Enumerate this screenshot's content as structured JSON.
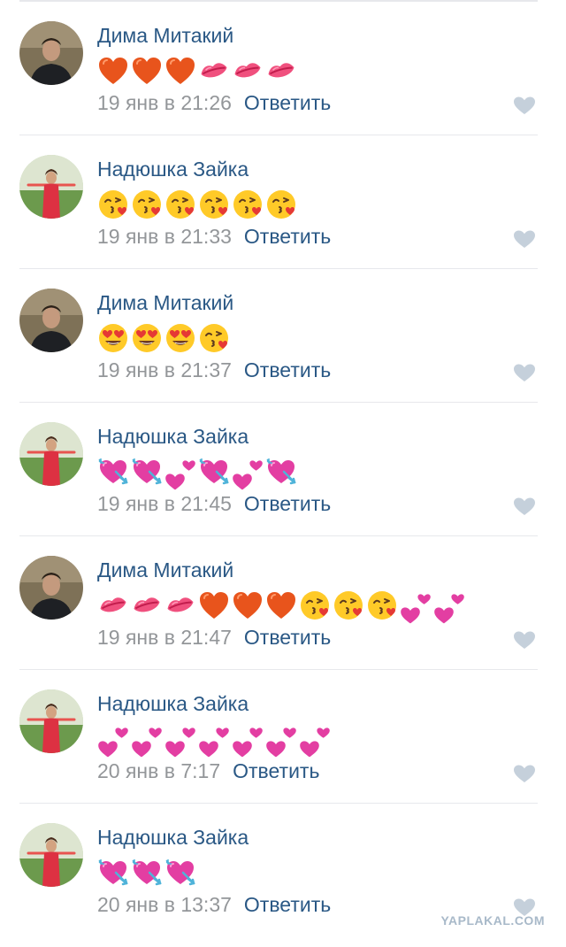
{
  "comments": [
    {
      "author": "Дима Митакий",
      "avatar": "man",
      "date": "19 янв в 21:26",
      "reply": "Ответить",
      "emojis": [
        "heart-icon",
        "heart-icon",
        "heart-icon",
        "kiss-mark-icon",
        "kiss-mark-icon",
        "kiss-mark-icon"
      ]
    },
    {
      "author": "Надюшка Зайка",
      "avatar": "woman",
      "date": "19 янв в 21:33",
      "reply": "Ответить",
      "emojis": [
        "face-blowing-kiss-icon",
        "face-blowing-kiss-icon",
        "face-blowing-kiss-icon",
        "face-blowing-kiss-icon",
        "face-blowing-kiss-icon",
        "face-blowing-kiss-icon"
      ]
    },
    {
      "author": "Дима Митакий",
      "avatar": "man",
      "date": "19 янв в 21:37",
      "reply": "Ответить",
      "emojis": [
        "heart-eyes-face-icon",
        "heart-eyes-face-icon",
        "heart-eyes-face-icon",
        "face-blowing-kiss-icon"
      ]
    },
    {
      "author": "Надюшка Зайка",
      "avatar": "woman",
      "date": "19 янв в 21:45",
      "reply": "Ответить",
      "emojis": [
        "heart-with-arrow-icon",
        "heart-with-arrow-icon",
        "two-hearts-icon",
        "heart-with-arrow-icon",
        "two-hearts-icon",
        "heart-with-arrow-icon"
      ]
    },
    {
      "author": "Дима Митакий",
      "avatar": "man",
      "date": "19 янв в 21:47",
      "reply": "Ответить",
      "emojis": [
        "kiss-mark-icon",
        "kiss-mark-icon",
        "kiss-mark-icon",
        "heart-icon",
        "heart-icon",
        "heart-icon",
        "face-blowing-kiss-icon",
        "face-blowing-kiss-icon",
        "face-blowing-kiss-icon",
        "two-hearts-icon",
        "two-hearts-icon"
      ]
    },
    {
      "author": "Надюшка Зайка",
      "avatar": "woman",
      "date": "20 янв в 7:17",
      "reply": "Ответить",
      "emojis": [
        "two-hearts-icon",
        "two-hearts-icon",
        "two-hearts-icon",
        "two-hearts-icon",
        "two-hearts-icon",
        "two-hearts-icon",
        "two-hearts-icon"
      ]
    },
    {
      "author": "Надюшка Зайка",
      "avatar": "woman",
      "date": "20 янв в 13:37",
      "reply": "Ответить",
      "emojis": [
        "heart-with-arrow-icon",
        "heart-with-arrow-icon",
        "heart-with-arrow-icon"
      ]
    }
  ],
  "watermark": "YAPLAKAL.COM",
  "colors": {
    "author": "#2a5885",
    "date": "#939699",
    "reply": "#2a5885",
    "like": "#c5d0db",
    "divider": "#e7e8ec"
  }
}
